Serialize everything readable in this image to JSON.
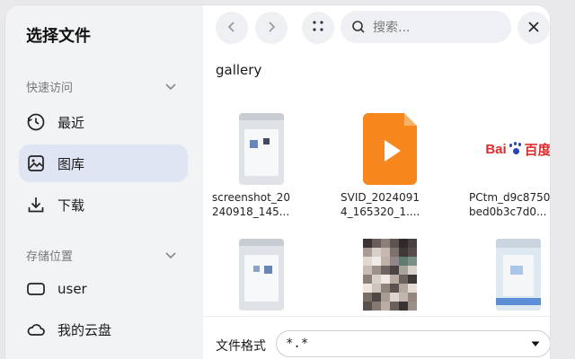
{
  "dialog": {
    "title": "选择文件"
  },
  "sidebar": {
    "quick_access": {
      "label": "快速访问",
      "items": [
        {
          "label": "最近",
          "icon": "clock-icon"
        },
        {
          "label": "图库",
          "icon": "image-icon",
          "active": true
        },
        {
          "label": "下载",
          "icon": "download-icon"
        }
      ]
    },
    "storage": {
      "label": "存储位置",
      "items": [
        {
          "label": "user",
          "icon": "drive-icon"
        },
        {
          "label": "我的云盘",
          "icon": "cloud-icon"
        }
      ]
    }
  },
  "toolbar": {
    "search_placeholder": "搜索..."
  },
  "folder": {
    "name": "gallery"
  },
  "files": [
    {
      "name": "screenshot_20\n240918_145...",
      "type": "screenshot"
    },
    {
      "name": "SVID_2024091\n4_165320_1....",
      "type": "video"
    },
    {
      "name": "PCtm_d9c8750\nbed0b3c7d0...",
      "type": "image",
      "logo_text": "Bai 百度"
    },
    {
      "name": "",
      "type": "screenshot"
    },
    {
      "name": "",
      "type": "photo"
    },
    {
      "name": "",
      "type": "screenshot"
    }
  ],
  "footer": {
    "format_label": "文件格式",
    "format_value": "*.*"
  },
  "colors": {
    "accent": "#dfe5f2",
    "sidebar_bg": "#f1f3f5",
    "video_orange": "#f7861c"
  }
}
